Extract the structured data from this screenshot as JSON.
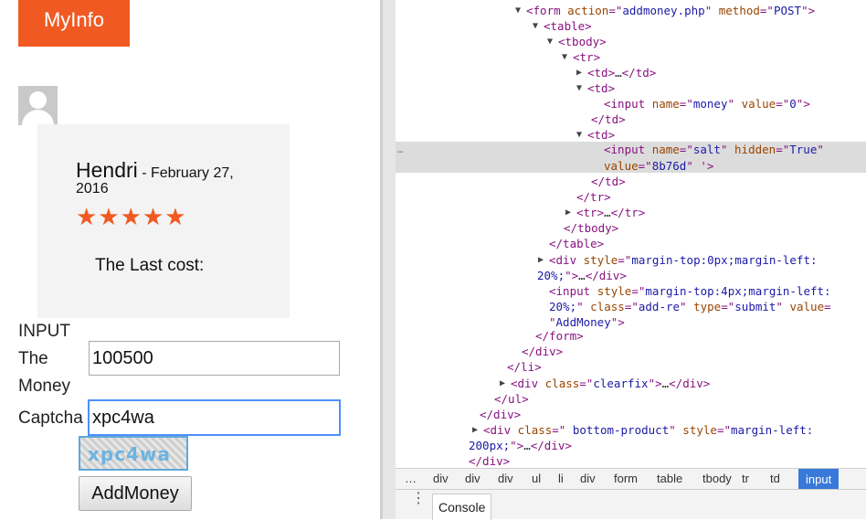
{
  "page": {
    "header_button": "MyInfo",
    "review": {
      "name": "Hendri",
      "date": " - February 27,",
      "year": "2016",
      "stars": "★★★★★",
      "last_cost_label": "The Last cost:"
    },
    "form": {
      "input_label": "INPUT",
      "the_label": "The",
      "money_label": "Money",
      "money_value": "100500",
      "captcha_label": "Captcha",
      "captcha_value": "xpc4wa",
      "captcha_image_text": "xpc4wa",
      "submit_label": "AddMoney"
    }
  },
  "devtools": {
    "lines": [
      {
        "parts": [
          [
            "tag",
            "<form "
          ],
          [
            "an",
            "action"
          ],
          [
            "tag",
            "=\""
          ],
          [
            "av",
            "addmoney.php"
          ],
          [
            "tag",
            "\" "
          ],
          [
            "an",
            "method"
          ],
          [
            "tag",
            "=\""
          ],
          [
            "av",
            "POST"
          ],
          [
            "tag",
            "\">"
          ]
        ]
      },
      {
        "parts": [
          [
            "tag",
            "<table>"
          ]
        ]
      },
      {
        "parts": [
          [
            "tag",
            "<tbody>"
          ]
        ]
      },
      {
        "parts": [
          [
            "tag",
            "<tr>"
          ]
        ]
      },
      {
        "parts": [
          [
            "tag",
            "<td>"
          ],
          [
            "tx",
            "…"
          ],
          [
            "tag",
            "</td>"
          ]
        ]
      },
      {
        "parts": [
          [
            "tag",
            "<td>"
          ]
        ]
      },
      {
        "parts": [
          [
            "tag",
            "<input "
          ],
          [
            "an",
            "name"
          ],
          [
            "tag",
            "=\""
          ],
          [
            "av",
            "money"
          ],
          [
            "tag",
            "\" "
          ],
          [
            "an",
            "value"
          ],
          [
            "tag",
            "=\""
          ],
          [
            "av",
            "0"
          ],
          [
            "tag",
            "\">"
          ]
        ]
      },
      {
        "parts": [
          [
            "tag",
            "</td>"
          ]
        ]
      },
      {
        "parts": [
          [
            "tag",
            "<td>"
          ]
        ]
      },
      {
        "parts": [
          [
            "tag",
            "<input "
          ],
          [
            "an",
            "name"
          ],
          [
            "tag",
            "=\""
          ],
          [
            "av",
            "salt"
          ],
          [
            "tag",
            "\" "
          ],
          [
            "an",
            "hidden"
          ],
          [
            "tag",
            "=\""
          ],
          [
            "av",
            "True"
          ],
          [
            "tag",
            "\""
          ]
        ]
      },
      {
        "parts": [
          [
            "an",
            "value"
          ],
          [
            "tag",
            "=\""
          ],
          [
            "av",
            "8b76d"
          ],
          [
            "tag",
            "\" '>"
          ]
        ]
      },
      {
        "parts": [
          [
            "tag",
            "</td>"
          ]
        ]
      },
      {
        "parts": [
          [
            "tag",
            "</tr>"
          ]
        ]
      },
      {
        "parts": [
          [
            "tag",
            "<tr>"
          ],
          [
            "tx",
            "…"
          ],
          [
            "tag",
            "</tr>"
          ]
        ]
      },
      {
        "parts": [
          [
            "tag",
            "</tbody>"
          ]
        ]
      },
      {
        "parts": [
          [
            "tag",
            "</table>"
          ]
        ]
      },
      {
        "parts": [
          [
            "tag",
            "<div "
          ],
          [
            "an",
            "style"
          ],
          [
            "tag",
            "=\""
          ],
          [
            "av",
            "margin-top:0px;margin-left:"
          ]
        ]
      },
      {
        "parts": [
          [
            "av",
            "20%;"
          ],
          [
            "tag",
            "\">"
          ],
          [
            "tx",
            "…"
          ],
          [
            "tag",
            "</div>"
          ]
        ]
      },
      {
        "parts": [
          [
            "tag",
            "<input "
          ],
          [
            "an",
            "style"
          ],
          [
            "tag",
            "=\""
          ],
          [
            "av",
            "margin-top:4px;margin-left:"
          ]
        ]
      },
      {
        "parts": [
          [
            "av",
            "20%;"
          ],
          [
            "tag",
            "\" "
          ],
          [
            "an",
            "class"
          ],
          [
            "tag",
            "=\""
          ],
          [
            "av",
            "add-re"
          ],
          [
            "tag",
            "\" "
          ],
          [
            "an",
            "type"
          ],
          [
            "tag",
            "=\""
          ],
          [
            "av",
            "submit"
          ],
          [
            "tag",
            "\" "
          ],
          [
            "an",
            "value"
          ],
          [
            "tag",
            "="
          ]
        ]
      },
      {
        "parts": [
          [
            "tag",
            "\""
          ],
          [
            "av",
            "AddMoney"
          ],
          [
            "tag",
            "\">"
          ]
        ]
      },
      {
        "parts": [
          [
            "tag",
            "</form>"
          ]
        ]
      },
      {
        "parts": [
          [
            "tag",
            "</div>"
          ]
        ]
      },
      {
        "parts": [
          [
            "tag",
            "</li>"
          ]
        ]
      },
      {
        "parts": [
          [
            "tag",
            "<div "
          ],
          [
            "an",
            "class"
          ],
          [
            "tag",
            "=\""
          ],
          [
            "av",
            "clearfix"
          ],
          [
            "tag",
            "\">"
          ],
          [
            "tx",
            "…"
          ],
          [
            "tag",
            "</div>"
          ]
        ]
      },
      {
        "parts": [
          [
            "tag",
            "</ul>"
          ]
        ]
      },
      {
        "parts": [
          [
            "tag",
            "</div>"
          ]
        ]
      },
      {
        "parts": [
          [
            "tag",
            "<div "
          ],
          [
            "an",
            "class"
          ],
          [
            "tag",
            "=\""
          ],
          [
            "av",
            " bottom-product"
          ],
          [
            "tag",
            "\" "
          ],
          [
            "an",
            "style"
          ],
          [
            "tag",
            "=\""
          ],
          [
            "av",
            "margin-left:"
          ]
        ]
      },
      {
        "parts": [
          [
            "av",
            "200px;"
          ],
          [
            "tag",
            "\">"
          ],
          [
            "tx",
            "…"
          ],
          [
            "tag",
            "</div>"
          ]
        ]
      },
      {
        "parts": [
          [
            "tag",
            "</div>"
          ]
        ]
      }
    ],
    "selected_marker": "…",
    "breadcrumbs": [
      "…",
      "div",
      "div",
      "div",
      "ul",
      "li",
      "div",
      "form",
      "table",
      "tbody",
      "tr",
      "td",
      "input"
    ],
    "drawer_menu": "⋮",
    "drawer_tab": "Console"
  }
}
